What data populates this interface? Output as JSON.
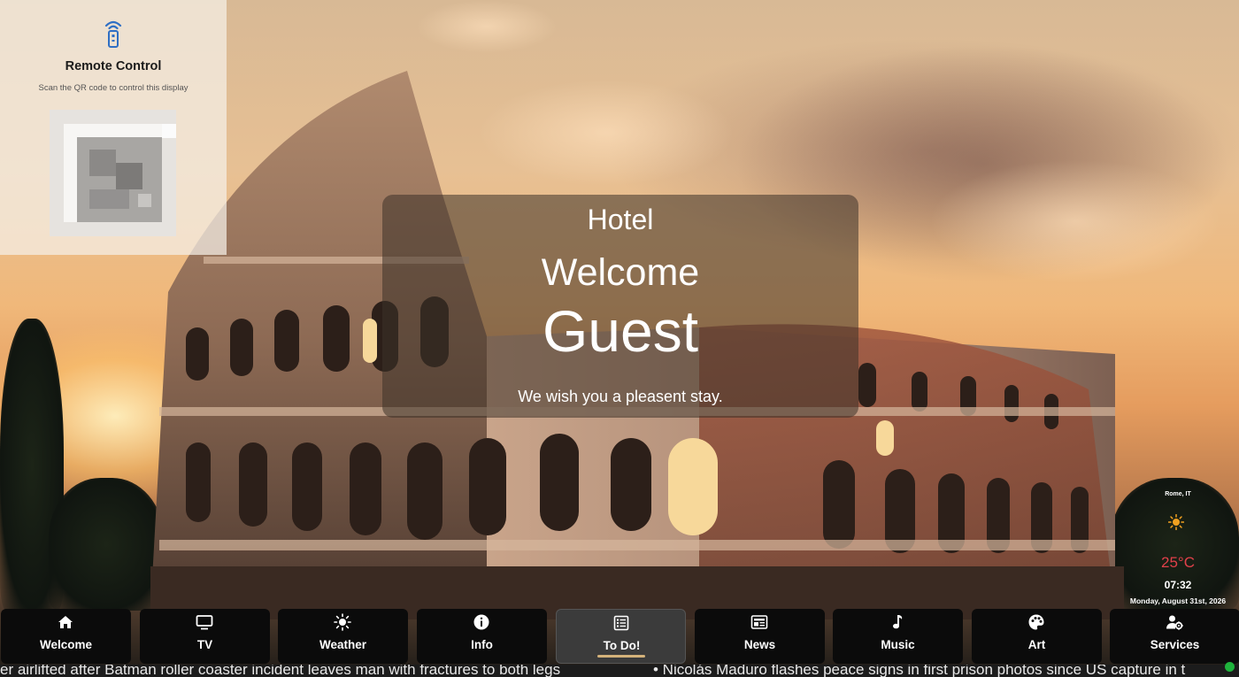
{
  "remote": {
    "icon": "remote-wifi-icon",
    "title": "Remote Control",
    "subtitle": "Scan the QR code to control this display"
  },
  "welcome": {
    "hotel": "Hotel",
    "welcome": "Welcome",
    "guest": "Guest",
    "message": "We wish you a pleasent stay."
  },
  "weather": {
    "city": "Rome, IT",
    "icon": "sun-icon",
    "temperature": "25°C",
    "time": "07:32",
    "date": "Monday, August 31st, 2026",
    "temperature_color": "#e0404a"
  },
  "nav": {
    "items": [
      {
        "label": "Welcome",
        "icon": "home-icon"
      },
      {
        "label": "TV",
        "icon": "tv-icon"
      },
      {
        "label": "Weather",
        "icon": "sun-icon"
      },
      {
        "label": "Info",
        "icon": "info-icon"
      },
      {
        "label": "To Do!",
        "icon": "list-icon",
        "active": true
      },
      {
        "label": "News",
        "icon": "newspaper-icon"
      },
      {
        "label": "Music",
        "icon": "music-note-icon"
      },
      {
        "label": "Art",
        "icon": "palette-icon"
      },
      {
        "label": "Services",
        "icon": "user-gear-icon"
      }
    ],
    "active_accent": "#d4b27a"
  },
  "ticker": {
    "headline_1": "er airlifted after Batman roller coaster incident leaves man with fractures to both legs",
    "headline_2": "• Nicolás Maduro flashes peace signs in first prison photos since US capture in t"
  },
  "status": {
    "online_color": "#1fb33c"
  }
}
